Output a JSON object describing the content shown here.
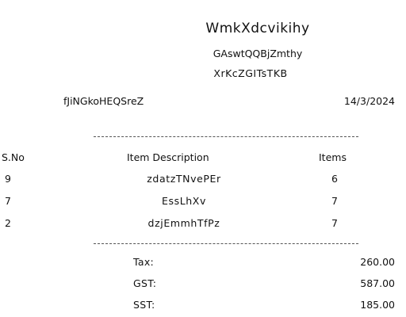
{
  "receipt": {
    "store_name": "WmkXdcvikihy",
    "address_line1": "GAswtQQBjZmthy",
    "address_line2": "XrKcZGITsTKB",
    "cashier": "fJiNGkoHEQSreZ",
    "date": "14/3/2024",
    "columns": {
      "sno": "S.No",
      "description": "Item Description",
      "items": "Items"
    },
    "rows": [
      {
        "sno": "9",
        "description": "zdatzTNvePEr",
        "items": "6"
      },
      {
        "sno": "7",
        "description": "EssLhXv",
        "items": "7"
      },
      {
        "sno": "2",
        "description": "dzjEmmhTfPz",
        "items": "7"
      }
    ],
    "totals": [
      {
        "label": "Tax:",
        "value": "260.00"
      },
      {
        "label": "GST:",
        "value": "587.00"
      },
      {
        "label": "SST:",
        "value": "185.00"
      }
    ]
  }
}
